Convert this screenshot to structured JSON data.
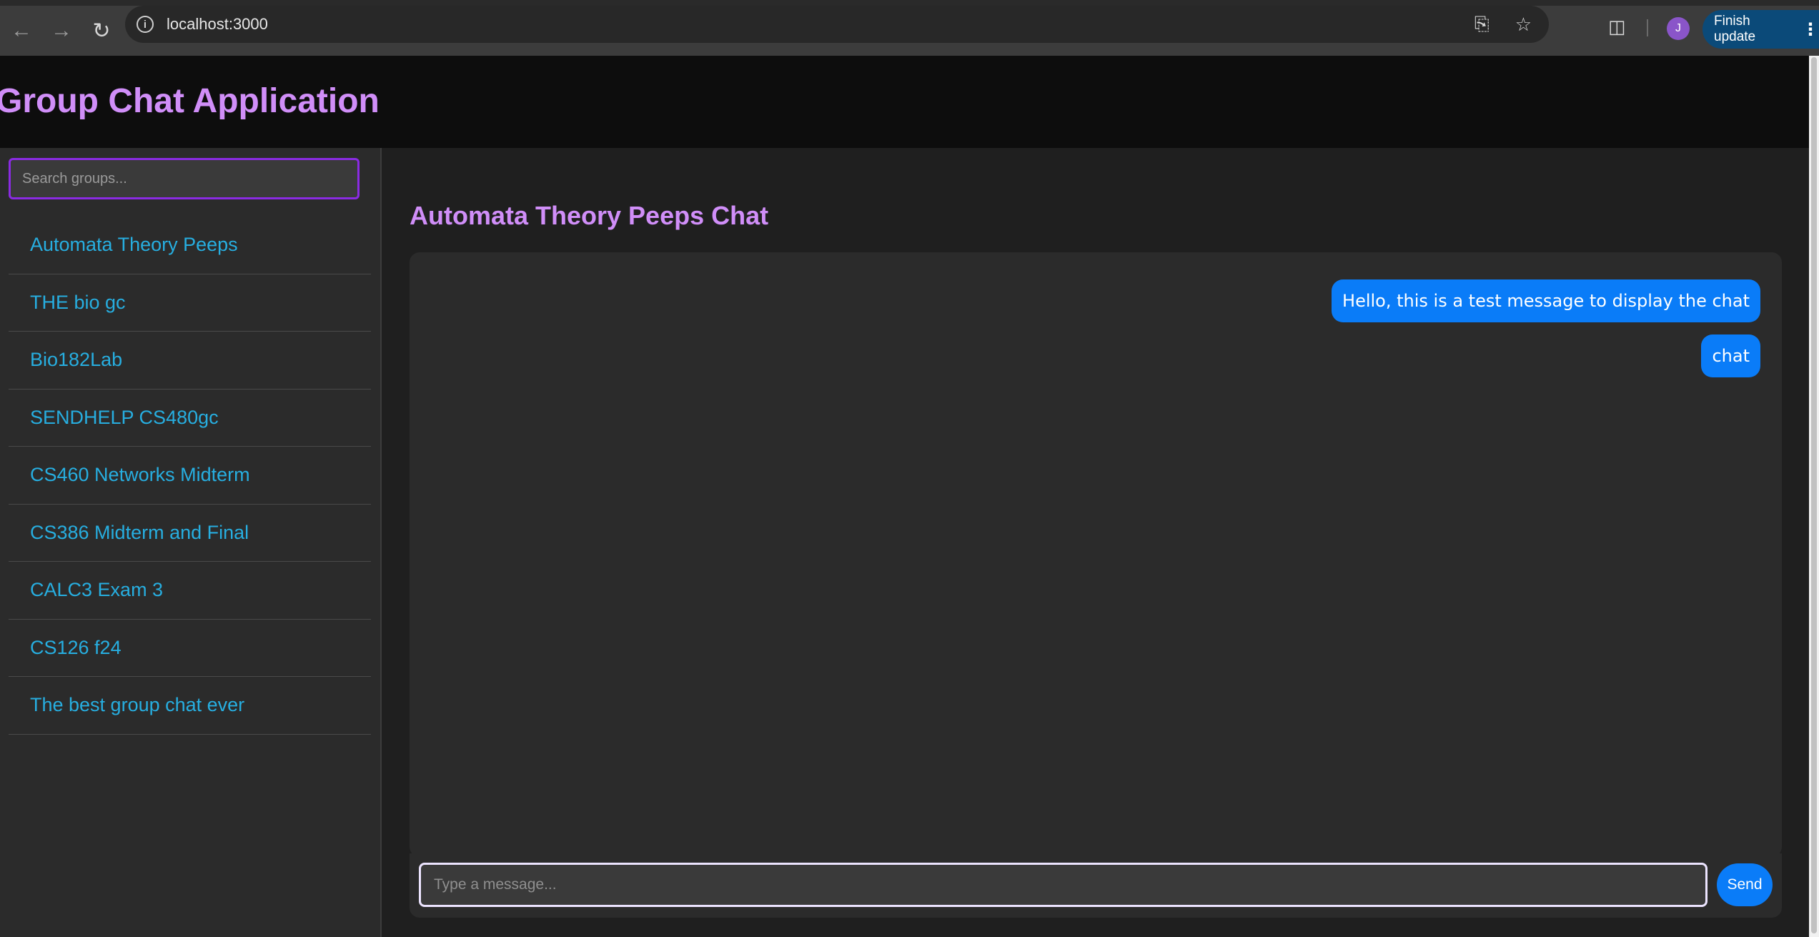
{
  "browser": {
    "url": "localhost:3000",
    "avatar_letter": "J",
    "finish_update_label": "Finish update",
    "icons": {
      "back": "arrow-left-icon",
      "forward": "arrow-right-icon",
      "reload": "reload-icon",
      "site_info": "info-icon",
      "install": "install-app-icon",
      "bookmark": "star-icon",
      "extensions": "puzzle-icon",
      "menu": "kebab-menu-icon"
    }
  },
  "header": {
    "title": "Group Chat Application"
  },
  "sidebar": {
    "search_placeholder": "Search groups...",
    "groups": [
      {
        "label": "Automata Theory Peeps"
      },
      {
        "label": "THE bio gc"
      },
      {
        "label": "Bio182Lab"
      },
      {
        "label": "SENDHELP CS480gc"
      },
      {
        "label": "CS460 Networks Midterm"
      },
      {
        "label": "CS386 Midterm and Final"
      },
      {
        "label": "CALC3 Exam 3"
      },
      {
        "label": "CS126 f24"
      },
      {
        "label": "The best group chat ever"
      }
    ]
  },
  "chat": {
    "title": "Automata Theory Peeps Chat",
    "messages": [
      {
        "text": "Hello, this is a test message to display the chat"
      },
      {
        "text": "chat"
      }
    ],
    "input_placeholder": "Type a message...",
    "send_label": "Send"
  },
  "colors": {
    "accent_purple": "#d08ef8",
    "link_blue": "#27aee0",
    "message_blue": "#0a7cf8",
    "search_border": "#8a2be2"
  }
}
